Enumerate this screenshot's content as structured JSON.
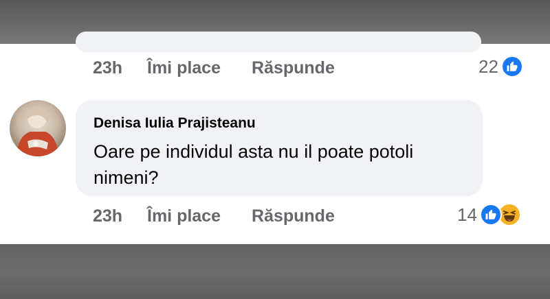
{
  "previous_comment": {
    "time": "23h",
    "like_label": "Îmi place",
    "reply_label": "Răspunde",
    "reaction_count": "22",
    "reactions": [
      "like-icon"
    ]
  },
  "comment": {
    "author": "Denisa Iulia Prajisteanu",
    "text_line1": "Oare pe individul asta nu il poate potoli",
    "text_line2": "nimeni?",
    "time": "23h",
    "like_label": "Îmi place",
    "reply_label": "Răspunde",
    "reaction_count": "14",
    "reactions": [
      "like-icon",
      "haha-icon"
    ]
  },
  "colors": {
    "like_blue": "#1877f2",
    "haha_yellow": "#f7b125",
    "meta_gray": "#65676b",
    "bubble_bg": "#f0f2f5"
  }
}
